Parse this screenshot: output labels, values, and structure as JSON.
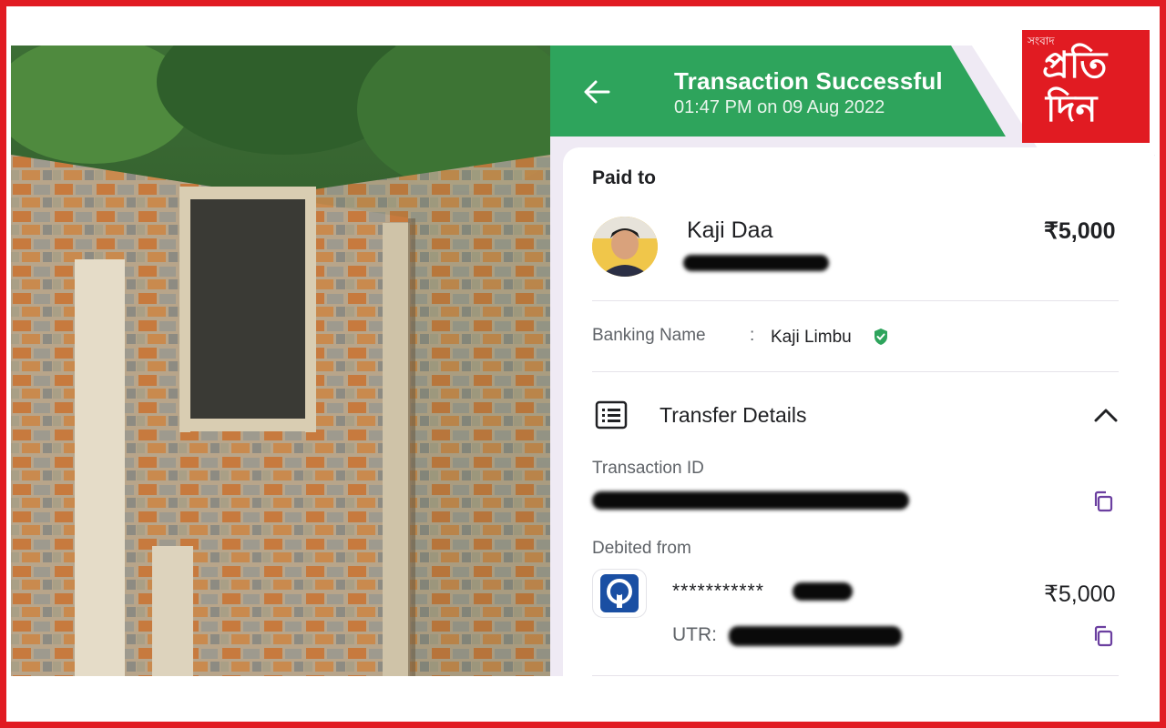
{
  "header": {
    "title": "Transaction Successful",
    "timestamp": "01:47 PM on 09 Aug 2022"
  },
  "payee": {
    "section_label": "Paid to",
    "name": "Kaji Daa",
    "amount": "₹5,000"
  },
  "banking": {
    "label": "Banking Name",
    "separator": ":",
    "value": "Kaji Limbu"
  },
  "transfer_details": {
    "title": "Transfer Details",
    "transaction_id_label": "Transaction ID",
    "debited_from_label": "Debited from",
    "account_masked": "***********",
    "amount": "₹5,000",
    "utr_label": "UTR:"
  },
  "logo": {
    "text_small": "সংবাদ",
    "text_line1": "প্রতি",
    "text_line2": "দিন"
  },
  "colors": {
    "header_green": "#2ea45c",
    "frame_red": "#e11b22",
    "accent_purple": "#6b3fa0",
    "verified_green": "#2ea45c"
  },
  "icons": [
    "back-arrow-icon",
    "verified-shield-icon",
    "list-details-icon",
    "chevron-up-icon",
    "copy-icon",
    "bank-logo-icon"
  ]
}
